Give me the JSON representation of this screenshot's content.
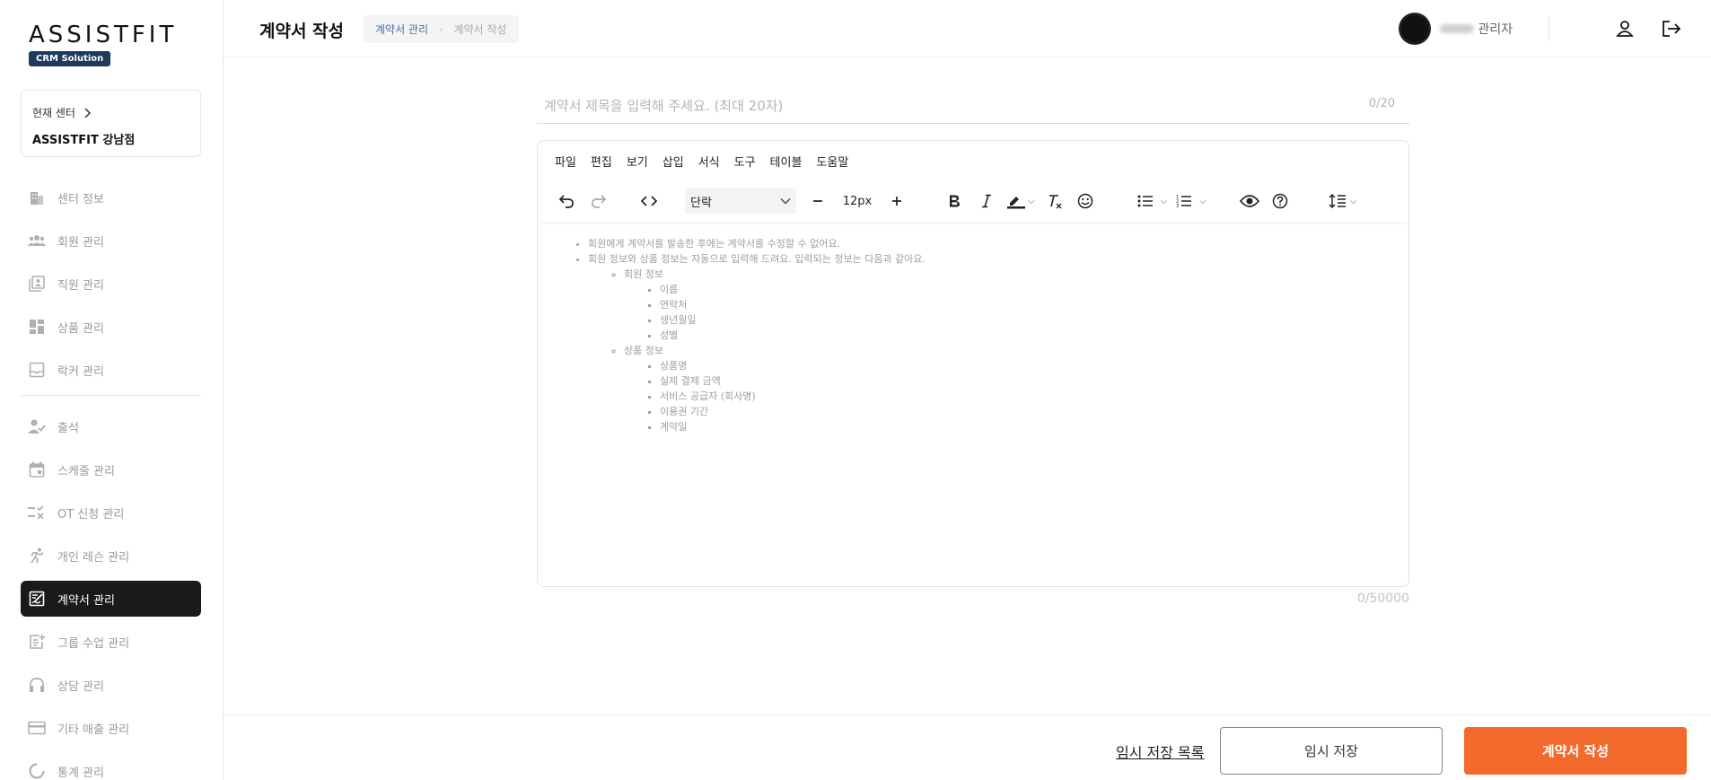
{
  "brand": {
    "logo": "ASSISTFIT",
    "badge": "CRM Solution"
  },
  "center": {
    "label": "현재 센터",
    "name": "ASSISTFIT 강남점"
  },
  "sidebar": {
    "group1": [
      {
        "label": "센터 정보",
        "icon": "building-icon"
      },
      {
        "label": "회원 관리",
        "icon": "members-icon"
      },
      {
        "label": "직원 관리",
        "icon": "staff-icon"
      },
      {
        "label": "상품 관리",
        "icon": "dashboard-icon"
      },
      {
        "label": "락커 관리",
        "icon": "inbox-icon"
      }
    ],
    "group2": [
      {
        "label": "출석",
        "icon": "user-check-icon"
      },
      {
        "label": "스케줄 관리",
        "icon": "calendar-icon"
      },
      {
        "label": "OT 신청 관리",
        "icon": "checklist-icon"
      },
      {
        "label": "개인 레슨 관리",
        "icon": "runner-icon"
      },
      {
        "label": "계약서 관리",
        "icon": "contract-icon",
        "active": true
      },
      {
        "label": "그룹 수업 관리",
        "icon": "add-note-icon"
      },
      {
        "label": "상담 관리",
        "icon": "headset-icon"
      },
      {
        "label": "기타 매출 관리",
        "icon": "card-icon"
      },
      {
        "label": "통계 관리",
        "icon": "chart-icon"
      }
    ]
  },
  "header": {
    "title": "계약서 작성",
    "breadcrumb": [
      "계약서 관리",
      "계약서 작성"
    ],
    "breadcrumb_sep": "›",
    "user_role": "관리자"
  },
  "editor": {
    "title_placeholder": "계약서 제목을 입력해 주세요. (최대 20자)",
    "title_count": "0/20",
    "menu": [
      "파일",
      "편집",
      "보기",
      "삽입",
      "서식",
      "도구",
      "테이블",
      "도움말"
    ],
    "block_format": "단락",
    "font_size": "12px",
    "body_count": "0/50000",
    "content": {
      "notice1": "회원에게 계약서를 발송한 후에는 계약서를 수정할 수 없어요.",
      "notice2": "회원 정보와 상품 정보는 자동으로 입력해 드려요. 입력되는 정보는 다음과 같아요.",
      "member_title": "회원 정보",
      "member_fields": [
        "이름",
        "연락처",
        "생년월일",
        "성별"
      ],
      "product_title": "상품 정보",
      "product_fields": [
        "상품명",
        "실제 결제 금액",
        "서비스 공급자 (회사명)",
        "이용권 기간",
        "계약일"
      ]
    }
  },
  "footer": {
    "draft_list": "임시 저장 목록",
    "draft_save": "임시 저장",
    "submit": "계약서 작성"
  },
  "colors": {
    "accent": "#f26b2c",
    "active_nav": "#1a1a1a",
    "badge": "#1f3a5f"
  }
}
